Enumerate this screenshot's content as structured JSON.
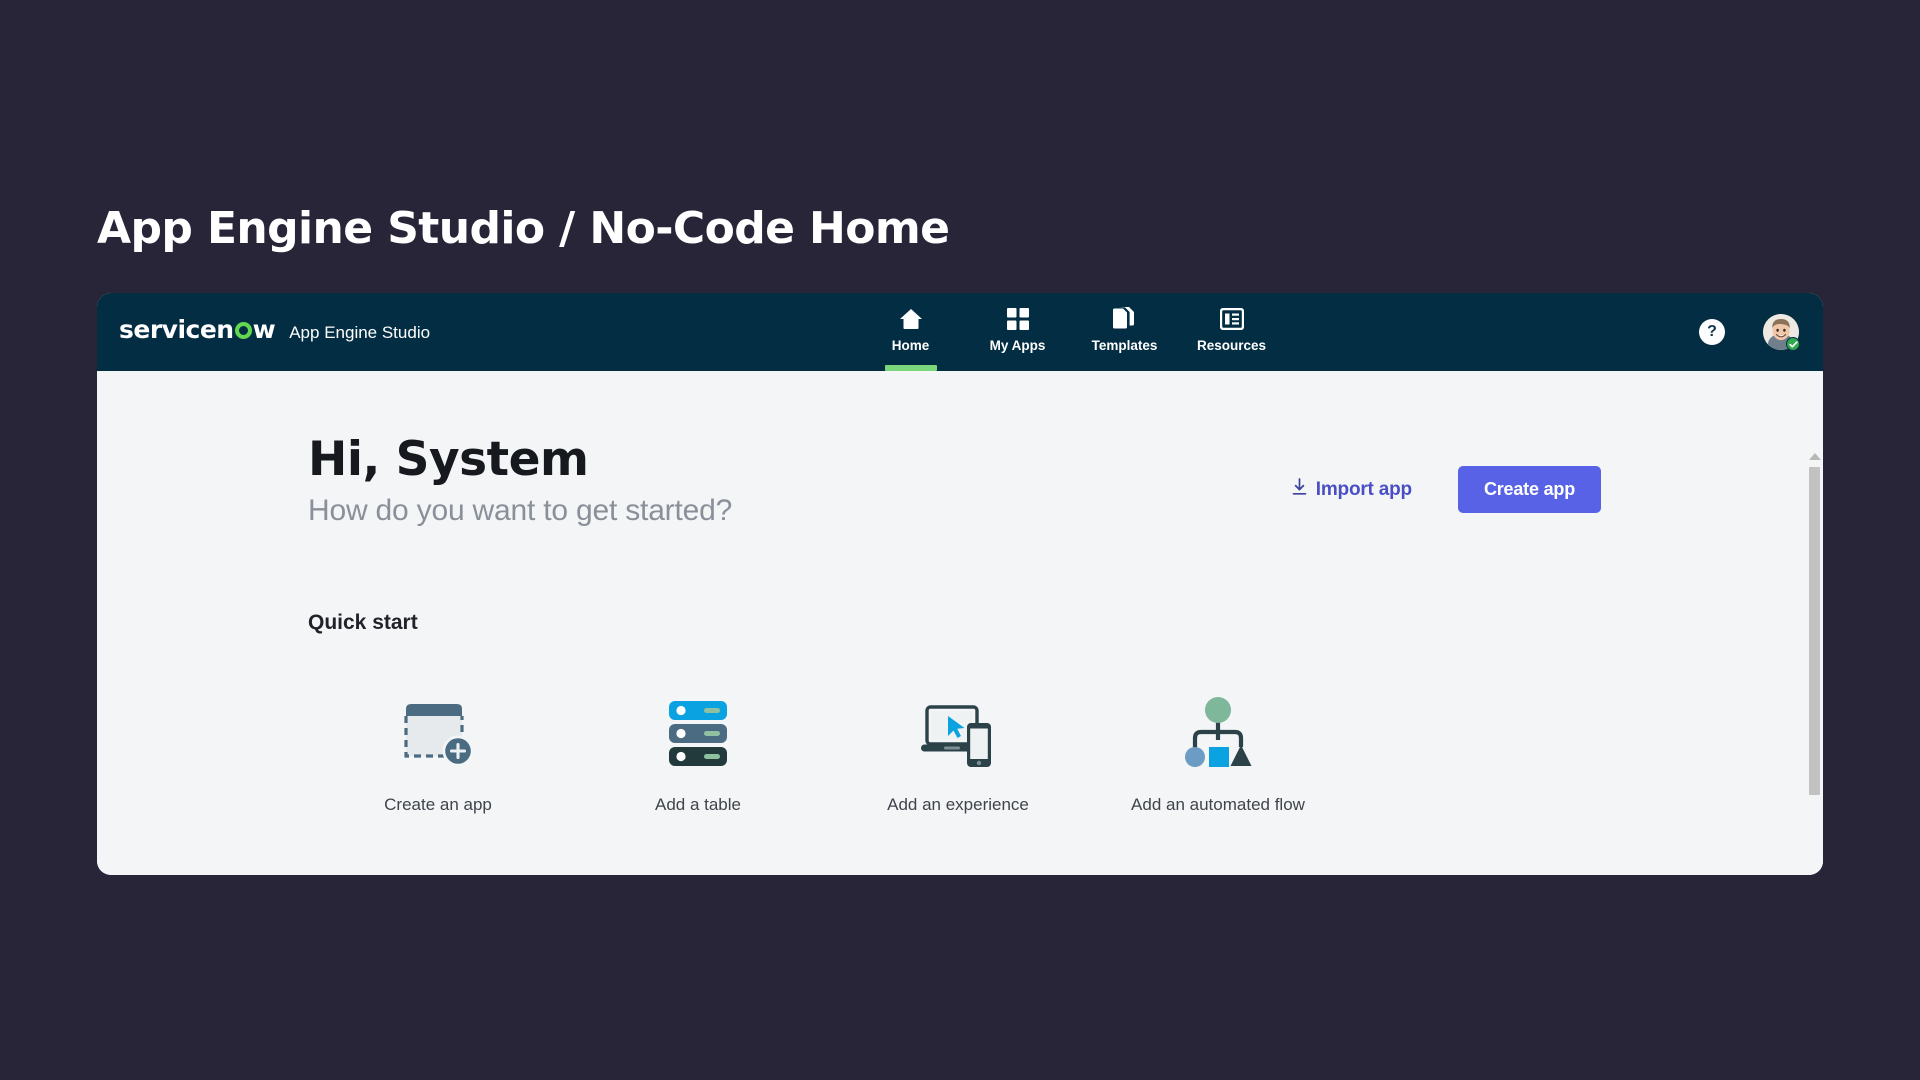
{
  "page": {
    "title": "App Engine Studio / No-Code Home",
    "background_color": "#272537"
  },
  "navbar": {
    "background_color": "#032d42",
    "logo_text_part1": "servicen",
    "logo_text_part2": "w",
    "product_name": "App Engine Studio",
    "active_indicator_color": "#7ad87a",
    "items": [
      {
        "label": "Home",
        "icon": "home-icon",
        "active": true
      },
      {
        "label": "My Apps",
        "icon": "grid-icon",
        "active": false
      },
      {
        "label": "Templates",
        "icon": "copy-pages-icon",
        "active": false
      },
      {
        "label": "Resources",
        "icon": "document-list-icon",
        "active": false
      }
    ],
    "help_label": "?",
    "help_icon": "question-mark-icon",
    "avatar_icon": "user-avatar",
    "status_icon": "check-badge-icon",
    "status_color": "#2fa84f"
  },
  "main": {
    "greeting": "Hi, System",
    "subtitle": "How do you want to get started?",
    "import_label": "Import app",
    "import_icon": "download-arrow-icon",
    "create_label": "Create app",
    "create_button_color": "#5762e6",
    "quick_start_heading": "Quick start",
    "tiles": [
      {
        "label": "Create an app",
        "icon": "new-app-window-icon"
      },
      {
        "label": "Add a table",
        "icon": "database-stack-icon"
      },
      {
        "label": "Add an experience",
        "icon": "laptop-phone-icon"
      },
      {
        "label": "Add an automated flow",
        "icon": "flow-tree-icon"
      }
    ]
  },
  "scrollbar": {
    "arrow_icon": "scroll-up-arrow-icon",
    "position_percent": 0
  }
}
